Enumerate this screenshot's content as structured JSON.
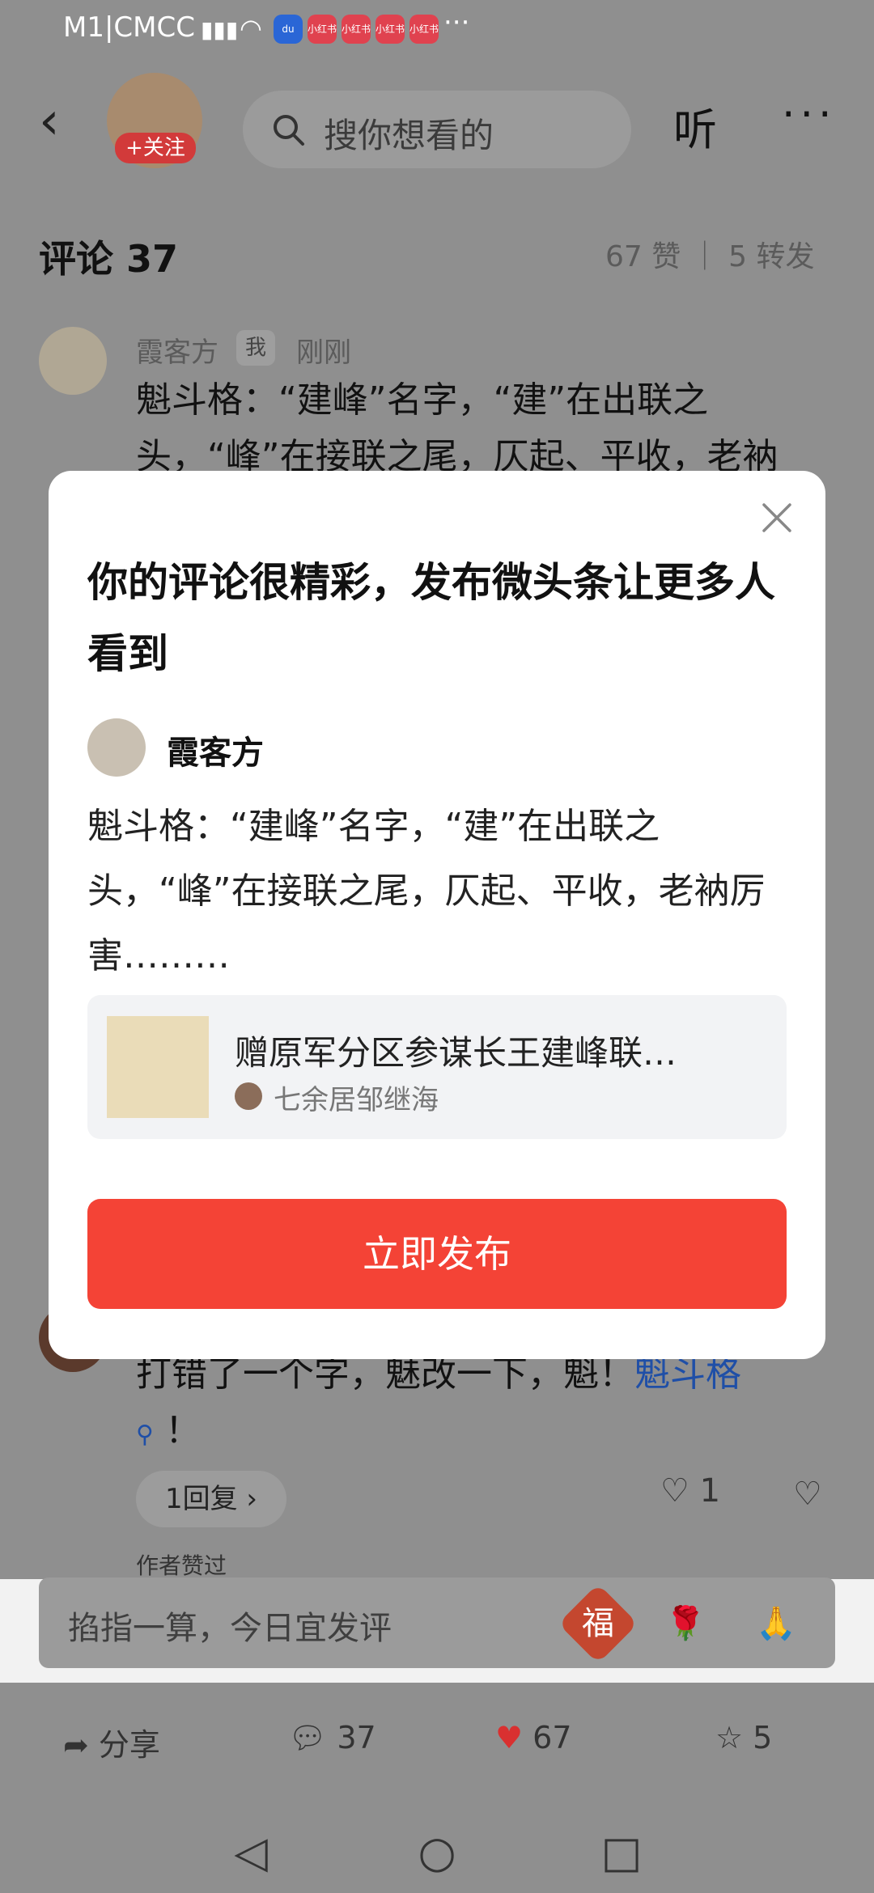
{
  "status_bar": {
    "carrier": "M1|CMCC",
    "app_badge": "小红书",
    "more": "···"
  },
  "header": {
    "follow_label": "+关注",
    "search_placeholder": "搜你想看的",
    "listen_label": "听",
    "more_label": "···"
  },
  "comments_header": {
    "title": "评论 37",
    "stats": "67 赞 ｜ 5 转发"
  },
  "comment1": {
    "author": "霞客方",
    "badge": "我",
    "time": "刚刚",
    "text": "魁斗格：“建峰”名字，“建”在出联之头，“峰”在接联之尾，仄起、平收，老衲"
  },
  "comment2": {
    "text_main": "打错了一个字，魅改一下，魁！",
    "link": "魁斗格",
    "text_tail": "！",
    "reply_label": "1回复 ›",
    "likes": "1",
    "author_liked": "作者赞过"
  },
  "input_bar": {
    "placeholder": "掐指一算，今日宜发评"
  },
  "bottom_bar": {
    "share": "分享",
    "comments": "37",
    "likes": "67",
    "favorites": "5",
    "accent_like": "#d93030"
  },
  "modal": {
    "title": "你的评论很精彩，发布微头条让更多人看到",
    "user": "霞客方",
    "text": "魁斗格：“建峰”名字，“建”在出联之头，“峰”在接联之尾，仄起、平收，老衲厉害………",
    "card_title": "赠原军分区参谋长王建峰联…",
    "card_author": "七余居邹继海",
    "publish_label": "立即发布",
    "publish_color": "#f44336"
  }
}
